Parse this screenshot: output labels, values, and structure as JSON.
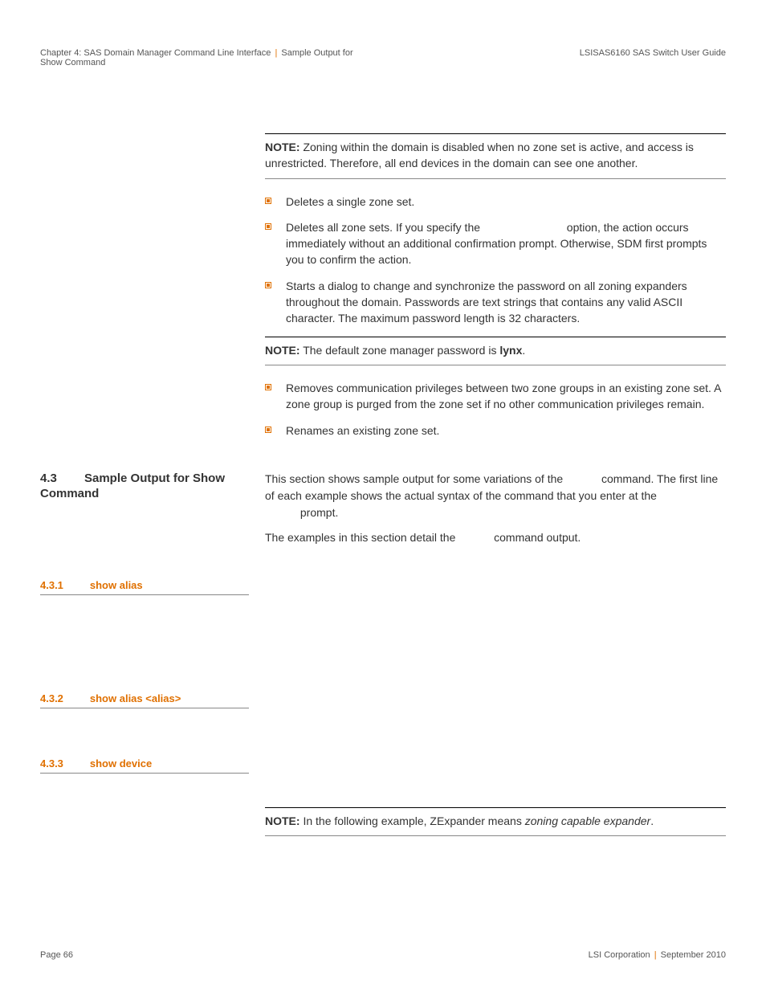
{
  "header": {
    "chapter": "Chapter 4: SAS Domain Manager Command Line Interface",
    "section": "Sample Output for Show Command",
    "doc_title": "LSISAS6160 SAS Switch User Guide"
  },
  "notes": {
    "note_label": "NOTE:",
    "zoning_disabled": "Zoning within the domain is disabled when no zone set is active, and access is unrestricted. Therefore, all end devices in the domain can see one another.",
    "default_password_pre": "The default zone manager password is ",
    "default_password_bold": "lynx",
    "default_password_post": ".",
    "zexpander_pre": "In the following example, ZExpander means ",
    "zexpander_italic": "zoning capable expander",
    "zexpander_post": "."
  },
  "bullets": {
    "b1": "Deletes a single zone set.",
    "b2_a": "Deletes all zone sets. If you specify the ",
    "b2_b": " option, the action occurs immediately without an additional confirmation prompt. Otherwise, SDM first prompts you to confirm the action.",
    "b3": "Starts a dialog to change and synchronize the password on all zoning expanders throughout the domain. Passwords are text strings that contains any valid ASCII character. The maximum password length is 32 characters.",
    "b4": "Removes communication privileges between two zone groups in an existing zone set. A zone group is purged from the zone set if no other communication privileges remain.",
    "b5": "Renames an existing zone set."
  },
  "section43": {
    "num": "4.3",
    "title": "Sample Output for Show Command",
    "para1_a": "This section shows sample output for some variations of the ",
    "para1_b": " command. The first line of each example shows the actual syntax of the command that you enter at the ",
    "para1_c": " prompt.",
    "para2_a": "The examples in this section detail the ",
    "para2_b": " command output."
  },
  "subs": {
    "s1_num": "4.3.1",
    "s1_title": "show alias",
    "s2_num": "4.3.2",
    "s2_title": "show alias <alias>",
    "s3_num": "4.3.3",
    "s3_title": "show device"
  },
  "footer": {
    "page": "Page 66",
    "corp": "LSI Corporation",
    "date": "September 2010"
  }
}
